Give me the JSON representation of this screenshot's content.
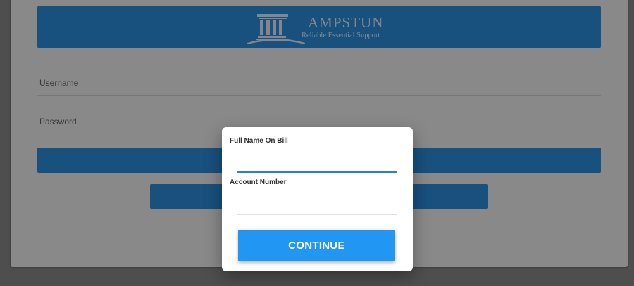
{
  "brand": {
    "name": "AMPSTUN",
    "tagline": "Reliable Essential Support",
    "logo_icon": "pillared-building-icon",
    "color": "#2b8fe0"
  },
  "login_form": {
    "username_placeholder": "Username",
    "password_placeholder": "Password"
  },
  "modal": {
    "full_name_label": "Full Name On Bill",
    "full_name_value": "",
    "account_number_label": "Account Number",
    "account_number_value": "",
    "continue_label": "CONTINUE",
    "button_color": "#2196f3"
  }
}
